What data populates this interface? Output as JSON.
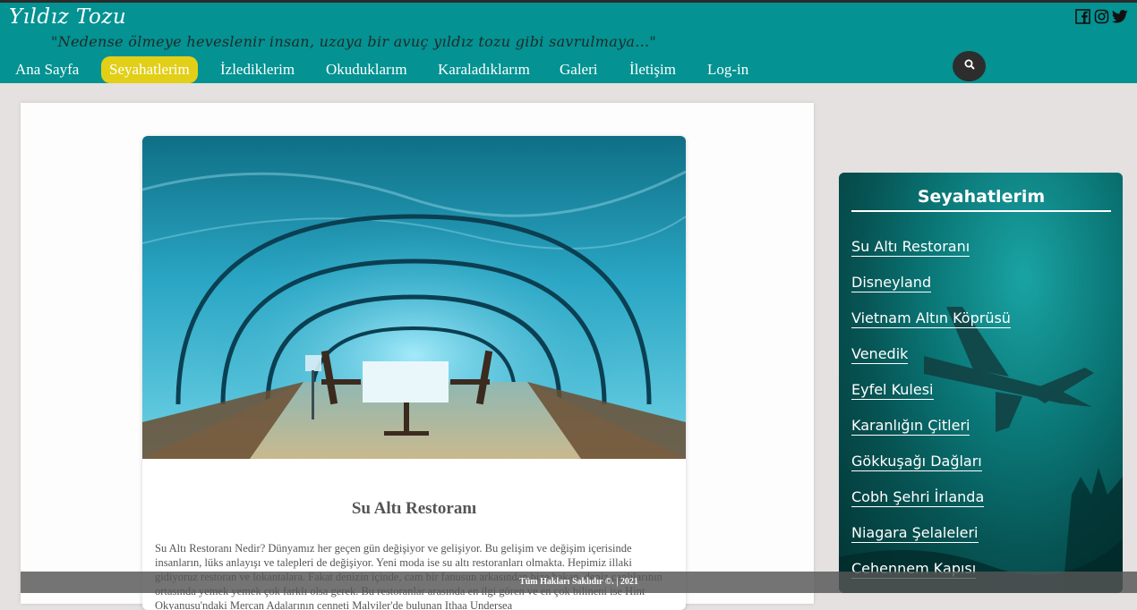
{
  "site": {
    "title": "Yıldız Tozu",
    "tagline": "\"Nedense ölmeye heveslenir insan, uzaya bir avuç yıldız tozu gibi savrulmaya...\""
  },
  "social": [
    "facebook-icon",
    "instagram-icon",
    "twitter-icon"
  ],
  "nav": {
    "items": [
      {
        "label": "Ana Sayfa"
      },
      {
        "label": "Seyahatlerim"
      },
      {
        "label": "İzlediklerim"
      },
      {
        "label": "Okuduklarım"
      },
      {
        "label": "Karaladıklarım"
      },
      {
        "label": "Galeri"
      },
      {
        "label": "İletişim"
      },
      {
        "label": "Log-in"
      }
    ],
    "active": "Seyahatlerim"
  },
  "post": {
    "title": "Su Altı Restoranı",
    "body": "Su Altı Restoranı Nedir? Dünyamız her geçen gün değişiyor ve gelişiyor. Bu gelişim ve değişim içerisinde insanların, lüks anlayışı ve talepleri de değişiyor. Yeni moda ise su altı restoranları olmakta. Hepimiz illaki gidiyoruz restoran ve lokantalara. Fakat denizin içinde, cam bir fanusun arkasından bize bakan, deniz canlılarının ortasında yemek yemek çok farklı olsa gerek. Bu restoranlar arasında en ilgi gören ve en çok bilineni ise Hint Okyanusu'ndaki Mercan Adalarının cenneti Malviler'de bulunan Ithaa Undersea"
  },
  "sidebar": {
    "title": "Seyahatlerim",
    "links": [
      {
        "label": "Su Altı Restoranı"
      },
      {
        "label": "Disneyland"
      },
      {
        "label": "Vietnam Altın Köprüsü"
      },
      {
        "label": "Venedik"
      },
      {
        "label": "Eyfel Kulesi"
      },
      {
        "label": "Karanlığın Çitleri"
      },
      {
        "label": "Gökkuşağı Dağları"
      },
      {
        "label": "Cobh Şehri İrlanda"
      },
      {
        "label": "Niagara Şelaleleri"
      },
      {
        "label": "Cehennem Kapısı"
      }
    ]
  },
  "footer": {
    "text": "Tüm Hakları Saklıdır ©. | 2021"
  },
  "colors": {
    "header": "#049292",
    "active_nav": "#e2cf18",
    "background": "#e4e1e0"
  }
}
